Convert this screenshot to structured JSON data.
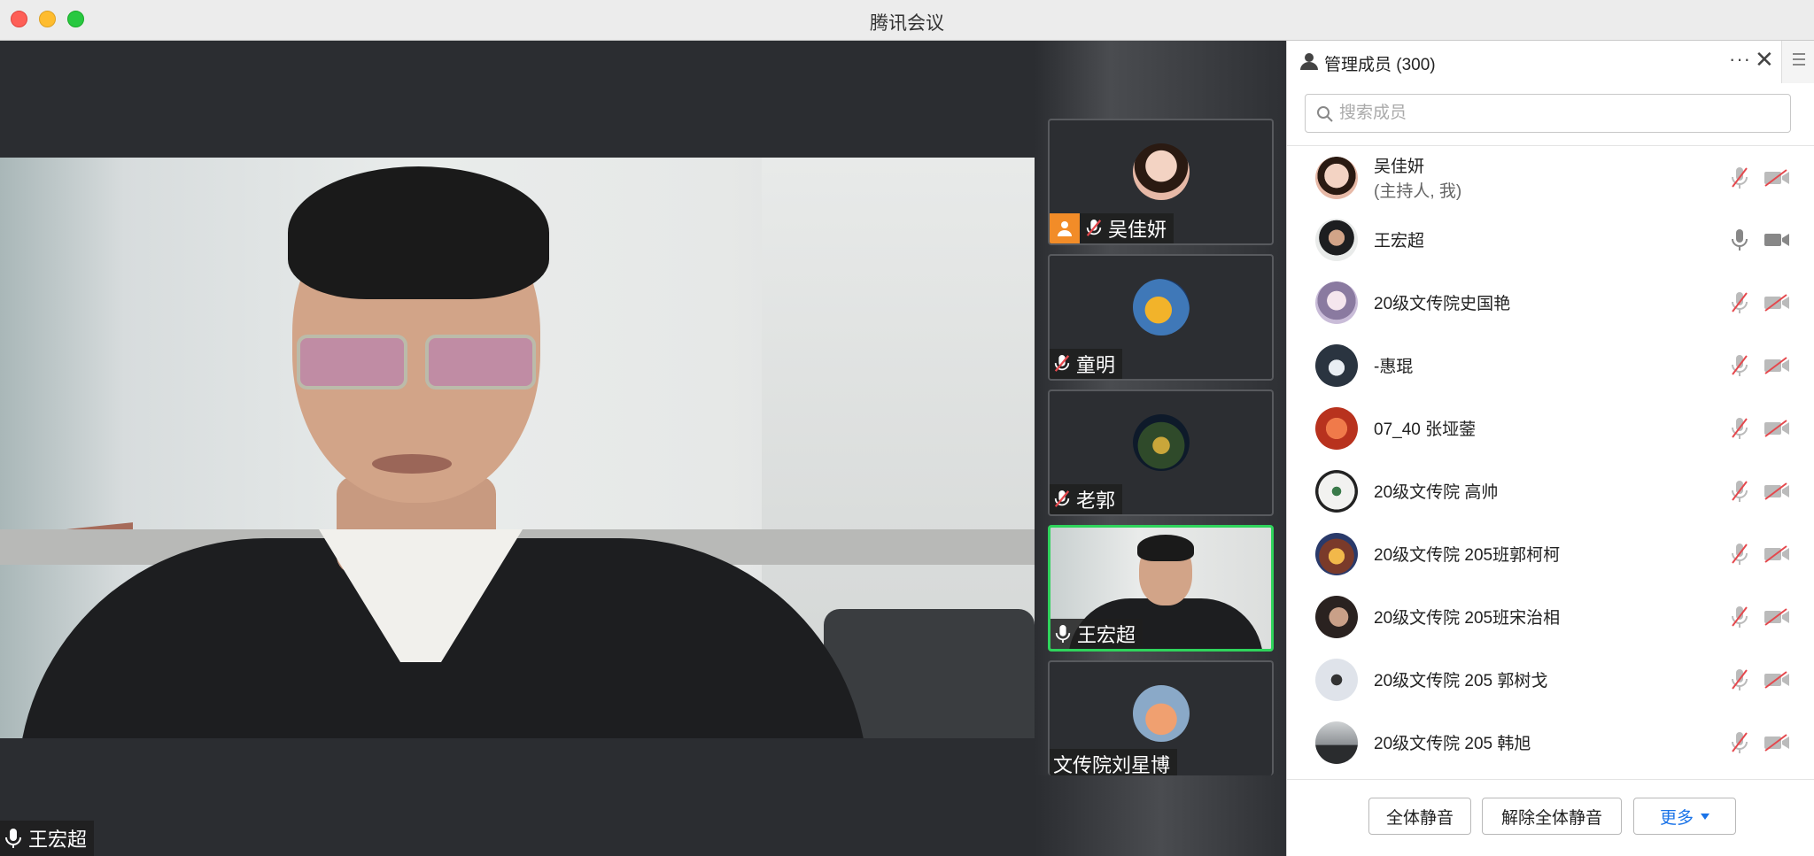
{
  "window": {
    "title": "腾讯会议"
  },
  "main_video": {
    "speaker_name": "王宏超"
  },
  "video_tiles": [
    {
      "name": "吴佳妍",
      "host": true,
      "muted": true
    },
    {
      "name": "童明",
      "host": false,
      "muted": true
    },
    {
      "name": "老郭",
      "host": false,
      "muted": true
    },
    {
      "name": "王宏超",
      "host": false,
      "muted": false,
      "active": true
    },
    {
      "name": "文传院刘星博",
      "host": false,
      "muted": null
    }
  ],
  "panel": {
    "title": "管理成员 (300)",
    "search_placeholder": "搜索成员",
    "members": [
      {
        "name": "吴佳妍",
        "role": "(主持人, 我)",
        "mic": "off",
        "video": "off"
      },
      {
        "name": "王宏超",
        "role": "",
        "mic": "on",
        "video": "on"
      },
      {
        "name": " 20级文传院史国艳",
        "role": "",
        "mic": "off",
        "video": "off"
      },
      {
        "name": "-惠琨",
        "role": "",
        "mic": "off",
        "video": "off"
      },
      {
        "name": "07_40 张垭蓥",
        "role": "",
        "mic": "off",
        "video": "off"
      },
      {
        "name": "20级文传院 高帅",
        "role": "",
        "mic": "off",
        "video": "off"
      },
      {
        "name": "20级文传院 205班郭柯柯",
        "role": "",
        "mic": "off",
        "video": "off"
      },
      {
        "name": "20级文传院 205班宋治相",
        "role": "",
        "mic": "off",
        "video": "off"
      },
      {
        "name": "20级文传院 205 郭树戈",
        "role": "",
        "mic": "off",
        "video": "off"
      },
      {
        "name": "20级文传院 205 韩旭",
        "role": "",
        "mic": "off",
        "video": "off"
      }
    ],
    "buttons": {
      "mute_all": "全体静音",
      "unmute_all": "解除全体静音",
      "more": "更多"
    }
  },
  "colors": {
    "active_border": "#2fd45c",
    "host_badge": "#f28c28",
    "muted_red": "#e5484d",
    "link_blue": "#1a73e8"
  }
}
